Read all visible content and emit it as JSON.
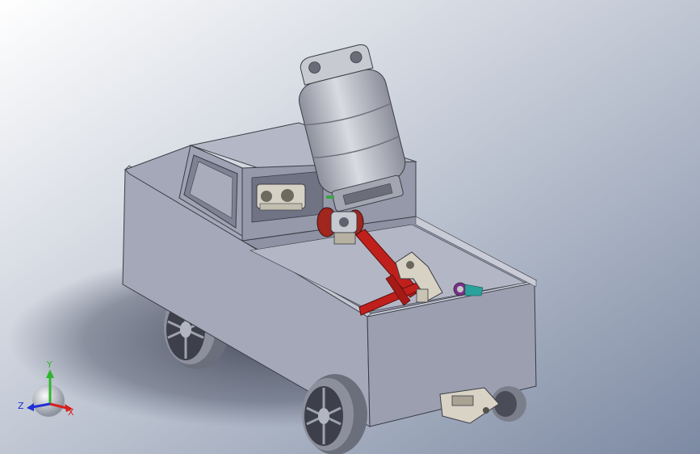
{
  "view": {
    "background_top": "#ffffff",
    "background_bottom": "#7d8aa3"
  },
  "triad": {
    "x_label": "X",
    "y_label": "Y",
    "z_label": "Z",
    "x_color": "#d61f1f",
    "y_color": "#2fb52f",
    "z_color": "#1f2fd6"
  },
  "model": {
    "body_color": "#a4a8b8",
    "body_shade": "#7f8394",
    "tank_color": "#b9bcc6",
    "rod_color": "#c0201c",
    "wheel_color": "#a8abb6",
    "parts": [
      "truck-body",
      "cab",
      "gas-cylinder",
      "crank-mechanism",
      "wheels",
      "tow-hitch"
    ]
  }
}
